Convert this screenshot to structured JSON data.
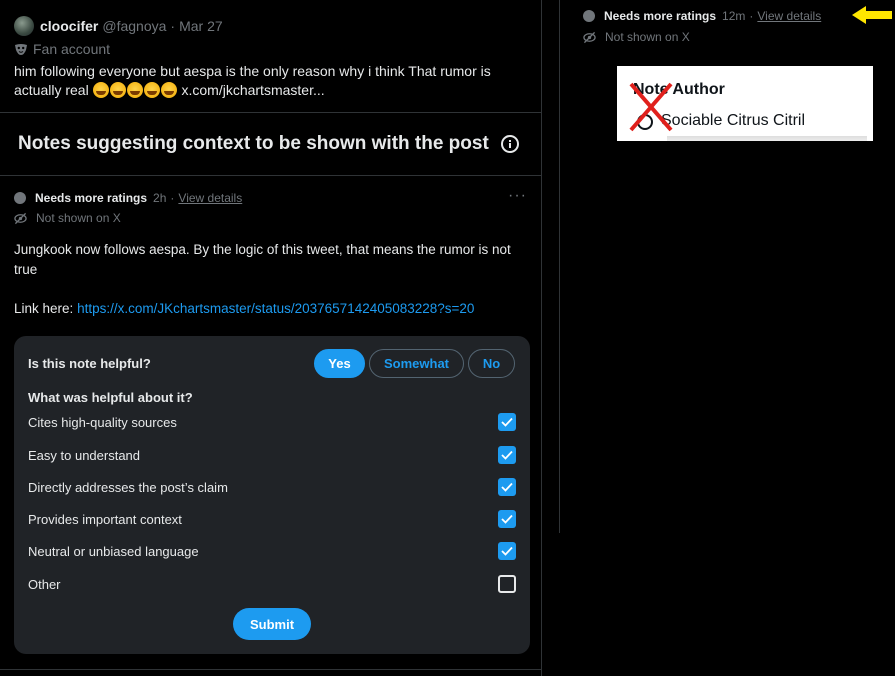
{
  "tweet": {
    "display_name": "cloocifer",
    "handle": "@fagnoya",
    "separator": "·",
    "date": "Mar 27",
    "badge_label": "Fan account",
    "text_line1": "him following everyone but aespa is the only reason why i think That rumor is",
    "text_line2_start": "actually real",
    "text_line2_end": "x.com/jkchartsmaster...",
    "emoji_count": 5
  },
  "notes_section": {
    "title": "Notes suggesting context to be shown with the post"
  },
  "note": {
    "status": "Needs more ratings",
    "time": "2h",
    "separator": "·",
    "view_details": "View details",
    "more": "···",
    "visibility": "Not shown on X",
    "body": "Jungkook now follows aespa. By the logic of this tweet, that means the rumor is not true",
    "link_prefix": "Link here:",
    "link_url": "https://x.com/JKchartsmaster/status/2037657142405083228?s=20"
  },
  "rating": {
    "question": "Is this note helpful?",
    "choices": {
      "yes": "Yes",
      "somewhat": "Somewhat",
      "no": "No"
    },
    "selected": "Yes",
    "helpful_question": "What was helpful about it?",
    "options": [
      {
        "label": "Cites high-quality sources",
        "checked": true
      },
      {
        "label": "Easy to understand",
        "checked": true
      },
      {
        "label": "Directly addresses the post’s claim",
        "checked": true
      },
      {
        "label": "Provides important context",
        "checked": true
      },
      {
        "label": "Neutral or unbiased language",
        "checked": true
      },
      {
        "label": "Other",
        "checked": false
      }
    ],
    "submit": "Submit"
  },
  "right_panel": {
    "status": "Needs more ratings",
    "time": "12m",
    "separator": "·",
    "view_details": "View details",
    "visibility": "Not shown on X",
    "author_card": {
      "title": "Note Author",
      "name": "Sociable Citrus Citril"
    }
  },
  "colors": {
    "background": "#000000",
    "accent": "#1d9bf0",
    "muted": "#71767b",
    "panel": "#202327",
    "arrow": "#ffe600",
    "cross": "#e0201c"
  }
}
